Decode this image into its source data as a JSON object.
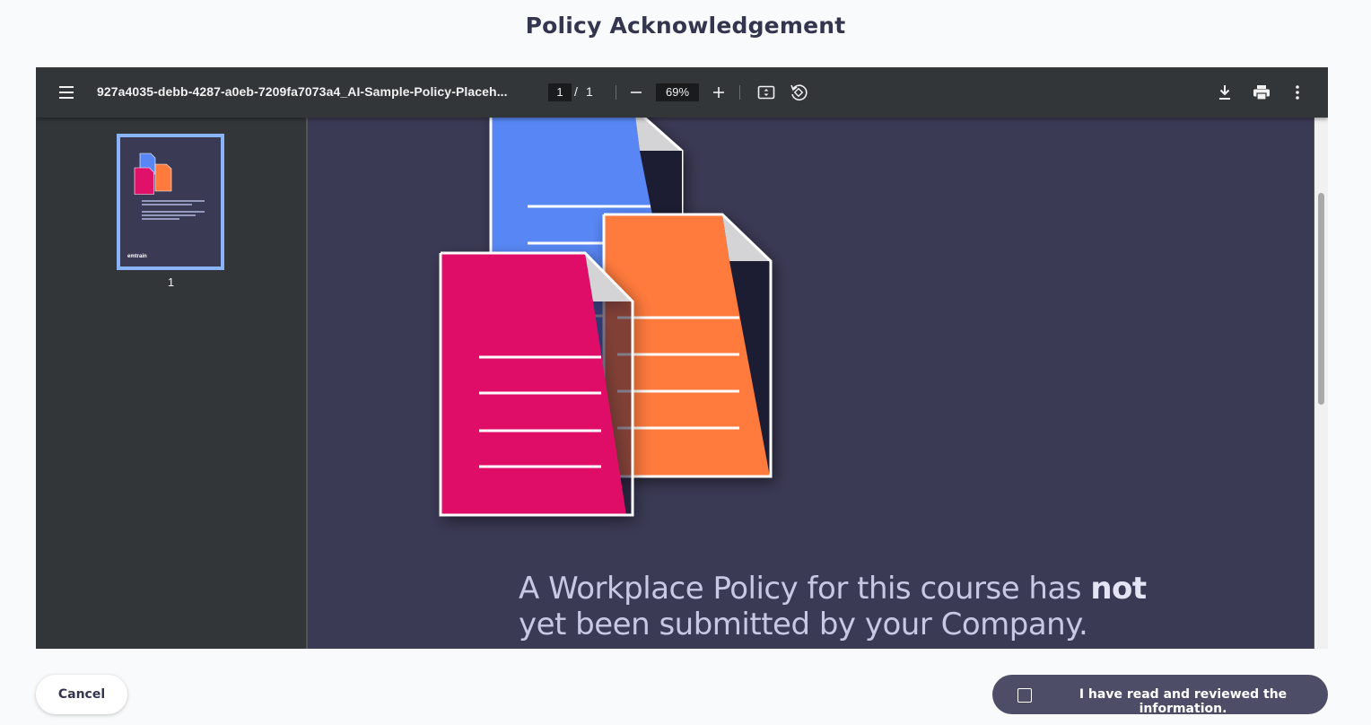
{
  "modal": {
    "title": "Policy Acknowledgement"
  },
  "viewer": {
    "filename": "927a4035-debb-4287-a0eb-7209fa7073a4_AI-Sample-Policy-Placeh...",
    "current_page": "1",
    "page_separator": "/",
    "total_pages": "1",
    "zoom": "69%",
    "icons": [
      "menu-icon",
      "zoom-out-icon",
      "zoom-in-icon",
      "fit-page-icon",
      "rotate-icon",
      "download-icon",
      "print-icon",
      "more-vert-icon"
    ]
  },
  "sidebar": {
    "thumbnail_label": "1",
    "thumbnail_logo": "emtrain"
  },
  "page": {
    "message_part1": "A Workplace Policy for this course has ",
    "message_bold": "not",
    "message_part2": "yet been submitted by your Company.",
    "illustration": "document-stack",
    "colors": {
      "background": "#3b3a55",
      "blue_doc": "#5887f5",
      "orange_doc": "#ff7a3d",
      "pink_doc": "#e01168"
    }
  },
  "footer": {
    "cancel_label": "Cancel",
    "acknowledge_label": "I have read and reviewed the information."
  }
}
